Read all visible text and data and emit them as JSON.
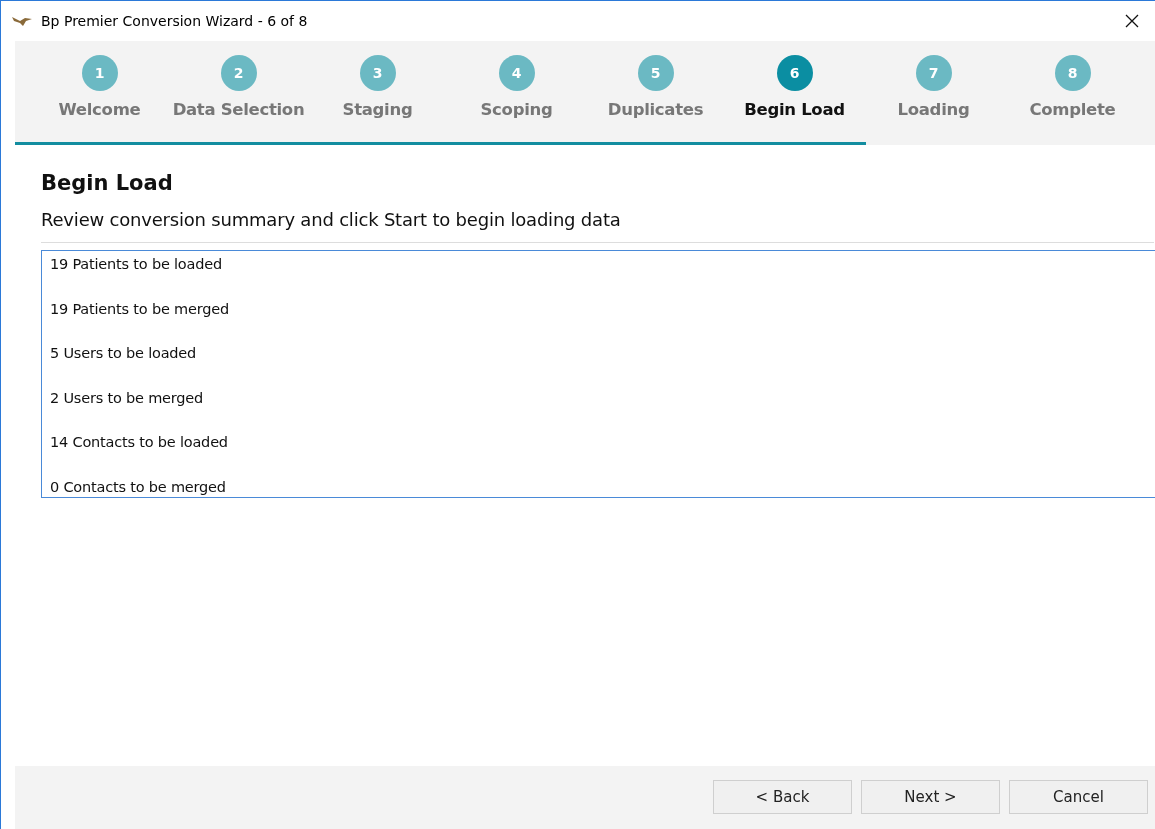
{
  "window": {
    "title": "Bp Premier Conversion Wizard - 6 of 8"
  },
  "steps": [
    {
      "number": "1",
      "label": "Welcome",
      "selected": false
    },
    {
      "number": "2",
      "label": "Data Selection",
      "selected": false
    },
    {
      "number": "3",
      "label": "Staging",
      "selected": false
    },
    {
      "number": "4",
      "label": "Scoping",
      "selected": false
    },
    {
      "number": "5",
      "label": "Duplicates",
      "selected": false
    },
    {
      "number": "6",
      "label": "Begin Load",
      "selected": true
    },
    {
      "number": "7",
      "label": "Loading",
      "selected": false
    },
    {
      "number": "8",
      "label": "Complete",
      "selected": false
    }
  ],
  "page": {
    "heading": "Begin Load",
    "subtitle": "Review conversion summary and click Start to begin loading data"
  },
  "summary": [
    "19 Patients to be loaded",
    "19 Patients to be merged",
    "5 Users to be loaded",
    "2 Users to be merged",
    "14 Contacts to be loaded",
    "0 Contacts to be merged"
  ],
  "buttons": [
    "< Back",
    "Next >",
    "Cancel"
  ]
}
